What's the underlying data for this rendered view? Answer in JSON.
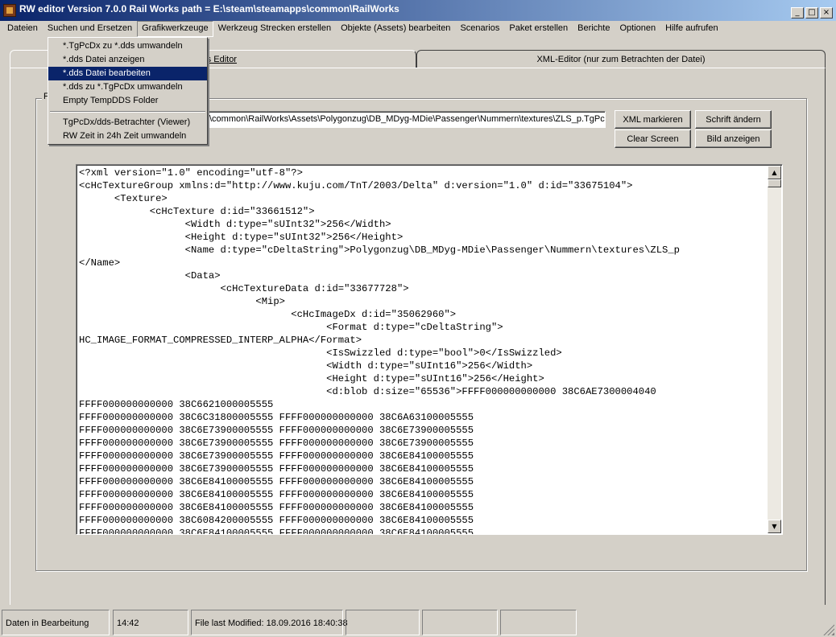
{
  "window": {
    "title": "RW editor  Version 7.0.0   Rail Works path = E:\\steam\\steamapps\\common\\RailWorks",
    "controls": [
      "_",
      "□",
      "×"
    ]
  },
  "menubar": {
    "items": [
      "Dateien",
      "Suchen und Ersetzen",
      "Grafikwerkzeuge",
      "Werkzeug Strecken erstellen",
      "Objekte (Assets) bearbeiten",
      "Scenarios",
      "Paket erstellen",
      "Berichte",
      "Optionen",
      "Hilfe aufrufen"
    ],
    "active": "Grafikwerkzeuge"
  },
  "dropdown": {
    "items": [
      "*.TgPcDx zu *.dds umwandeln",
      "*.dds Datei anzeigen",
      "*.dds Datei bearbeiten",
      "*.dds zu *.TgPcDx umwandeln",
      "Empty TempDDS Folder"
    ],
    "items2": [
      "TgPcDx/dds-Betrachter (Viewer)",
      "RW Zeit in 24h Zeit umwandeln"
    ],
    "highlighted": "*.dds Datei bearbeiten"
  },
  "tabs": {
    "tab1_label": "pols Editor",
    "tab2_label": "XML-Editor (nur zum Betrachten der Datei)"
  },
  "group": {
    "label": "F"
  },
  "path_field": {
    "value": "\\common\\RailWorks\\Assets\\Polygonzug\\DB_MDyg-MDie\\Passenger\\Nummern\\textures\\ZLS_p.TgPc"
  },
  "buttons": {
    "xml_markieren": "XML markieren",
    "schrift_aendern": "Schrift ändern",
    "clear_screen": "Clear Screen",
    "bild_anzeigen": "Bild anzeigen"
  },
  "editor": {
    "lines": [
      "<?xml version=\"1.0\" encoding=\"utf-8\"?>",
      "<cHcTextureGroup xmlns:d=\"http://www.kuju.com/TnT/2003/Delta\" d:version=\"1.0\" d:id=\"33675104\">",
      "      <Texture>",
      "            <cHcTexture d:id=\"33661512\">",
      "                  <Width d:type=\"sUInt32\">256</Width>",
      "                  <Height d:type=\"sUInt32\">256</Height>",
      "                  <Name d:type=\"cDeltaString\">Polygonzug\\DB_MDyg-MDie\\Passenger\\Nummern\\textures\\ZLS_p",
      "</Name>",
      "                  <Data>",
      "                        <cHcTextureData d:id=\"33677728\">",
      "                              <Mip>",
      "                                    <cHcImageDx d:id=\"35062960\">",
      "                                          <Format d:type=\"cDeltaString\">",
      "HC_IMAGE_FORMAT_COMPRESSED_INTERP_ALPHA</Format>",
      "                                          <IsSwizzled d:type=\"bool\">0</IsSwizzled>",
      "                                          <Width d:type=\"sUInt16\">256</Width>",
      "                                          <Height d:type=\"sUInt16\">256</Height>",
      "                                          <d:blob d:size=\"65536\">FFFF000000000000 38C6AE7300004040",
      "FFFF000000000000 38C6621000005555",
      "FFFF000000000000 38C6C31800005555 FFFF000000000000 38C6A63100005555",
      "FFFF000000000000 38C6E73900005555 FFFF000000000000 38C6E73900005555",
      "FFFF000000000000 38C6E73900005555 FFFF000000000000 38C6E73900005555",
      "FFFF000000000000 38C6E73900005555 FFFF000000000000 38C6E84100005555",
      "FFFF000000000000 38C6E73900005555 FFFF000000000000 38C6E84100005555",
      "FFFF000000000000 38C6E84100005555 FFFF000000000000 38C6E84100005555",
      "FFFF000000000000 38C6E84100005555 FFFF000000000000 38C6E84100005555",
      "FFFF000000000000 38C6E84100005555 FFFF000000000000 38C6E84100005555",
      "FFFF000000000000 38C6084200005555 FFFF000000000000 38C6E84100005555",
      "FFFF000000000000 38C6E84100005555 FFFF000000000000 38C6E84100005555"
    ]
  },
  "statusbar": {
    "status": "Daten in Bearbeitung",
    "time": "14:42",
    "modified": "File last Modified: 18.09.2016 18:40:38"
  }
}
